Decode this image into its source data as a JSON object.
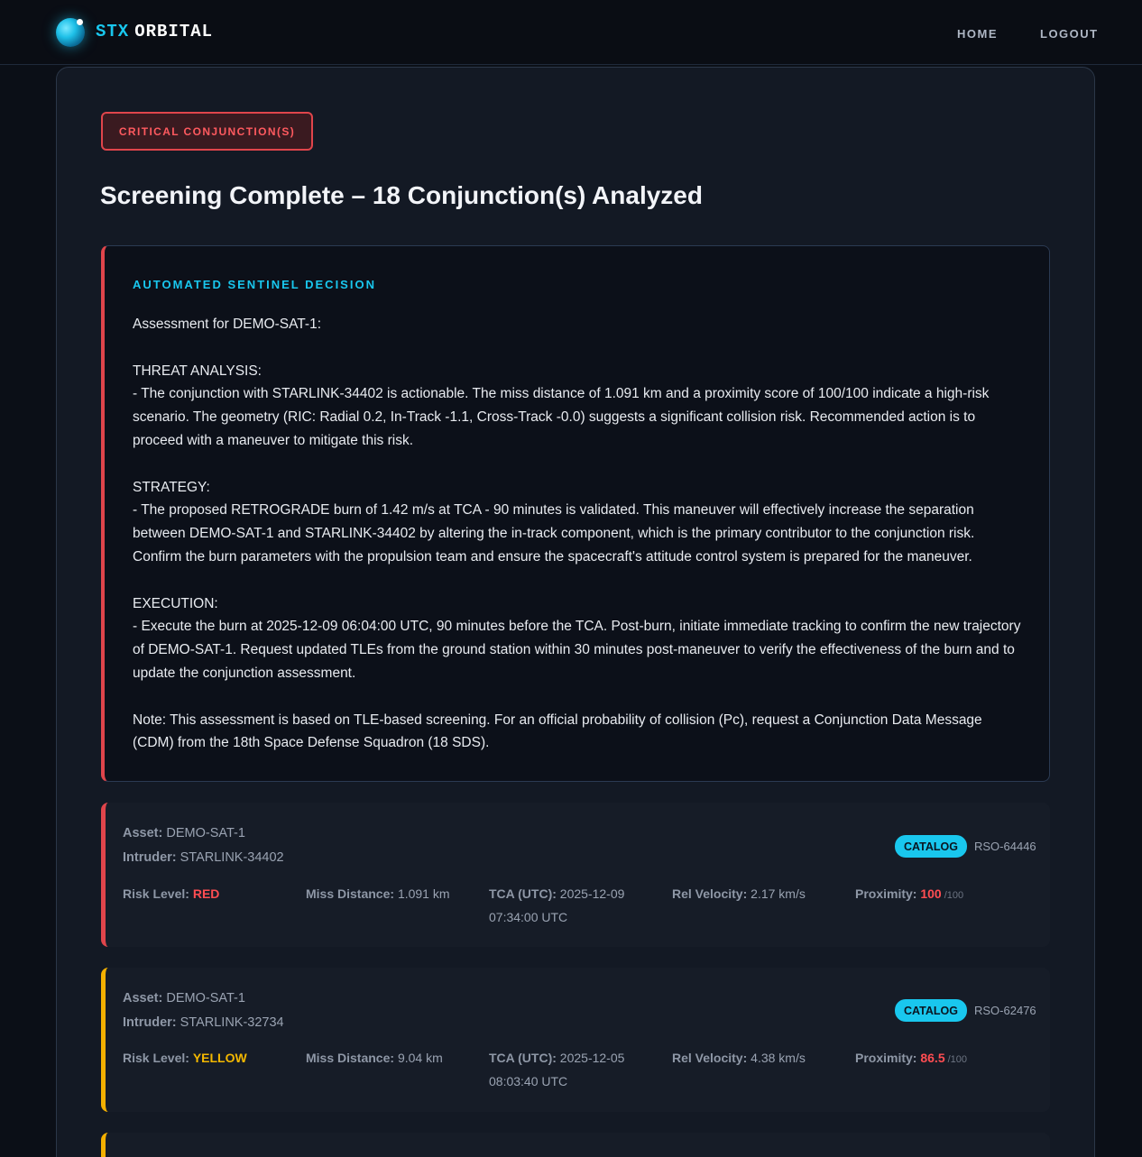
{
  "nav": {
    "brand_part1": "STX",
    "brand_part2": "ORBITAL",
    "links": [
      "HOME",
      "LOGOUT"
    ]
  },
  "status_badge": "CRITICAL CONJUNCTION(S)",
  "page_title": "Screening Complete – 18 Conjunction(s) Analyzed",
  "decision": {
    "heading": "AUTOMATED SENTINEL DECISION",
    "body": "Assessment for DEMO-SAT-1:\n\nTHREAT ANALYSIS:\n- The conjunction with STARLINK-34402 is actionable. The miss distance of 1.091 km and a proximity score of 100/100 indicate a high-risk scenario. The geometry (RIC: Radial 0.2, In-Track -1.1, Cross-Track -0.0) suggests a significant collision risk. Recommended action is to proceed with a maneuver to mitigate this risk.\n\nSTRATEGY:\n- The proposed RETROGRADE burn of 1.42 m/s at TCA - 90 minutes is validated. This maneuver will effectively increase the separation between DEMO-SAT-1 and STARLINK-34402 by altering the in-track component, which is the primary contributor to the conjunction risk. Confirm the burn parameters with the propulsion team and ensure the spacecraft's attitude control system is prepared for the maneuver.\n\nEXECUTION:\n- Execute the burn at 2025-12-09 06:04:00 UTC, 90 minutes before the TCA. Post-burn, initiate immediate tracking to confirm the new trajectory of DEMO-SAT-1. Request updated TLEs from the ground station within 30 minutes post-maneuver to verify the effectiveness of the burn and to update the conjunction assessment.\n\nNote: This assessment is based on TLE-based screening. For an official probability of collision (Pc), request a Conjunction Data Message (CDM) from the 18th Space Defense Squadron (18 SDS)."
  },
  "labels": {
    "asset": "Asset:",
    "intruder": "Intruder:",
    "risk_level": "Risk Level:",
    "miss_distance": "Miss Distance:",
    "tca": "TCA (UTC):",
    "rel_velocity": "Rel Velocity:",
    "proximity": "Proximity:",
    "proximity_max": "/100"
  },
  "conjunctions": [
    {
      "asset": "DEMO-SAT-1",
      "intruder": "STARLINK-34402",
      "source_badge": "CATALOG",
      "rso_id": "RSO-64446",
      "risk_level": "RED",
      "miss_distance": "1.091 km",
      "tca_date": "2025-12-09",
      "tca_time": "07:34:00 UTC",
      "rel_velocity": "2.17 km/s",
      "proximity": "100",
      "color": "#e0454b"
    },
    {
      "asset": "DEMO-SAT-1",
      "intruder": "STARLINK-32734",
      "source_badge": "CATALOG",
      "rso_id": "RSO-62476",
      "risk_level": "YELLOW",
      "miss_distance": "9.04 km",
      "tca_date": "2025-12-05",
      "tca_time": "08:03:40 UTC",
      "rel_velocity": "4.38 km/s",
      "proximity": "86.5",
      "color": "#f4b000"
    }
  ],
  "colors": {
    "accent": "#19c7ee",
    "critical": "#e0454b",
    "warning": "#f4b000",
    "background": "#0b0f17",
    "panel": "#131924"
  }
}
